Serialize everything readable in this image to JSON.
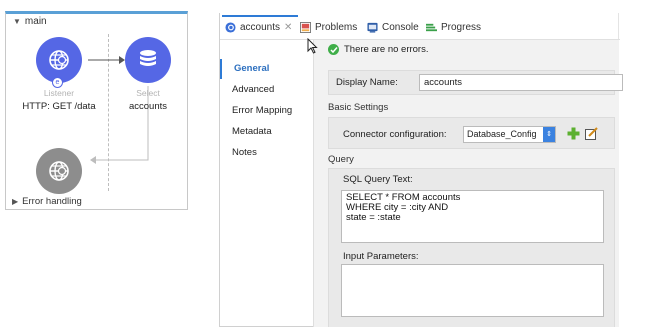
{
  "flow": {
    "name": "main",
    "listener": {
      "type": "Listener",
      "name": "HTTP: GET /data"
    },
    "select": {
      "type": "Select",
      "name": "accounts"
    },
    "error_handling": "Error handling"
  },
  "tabs": [
    {
      "label": "accounts"
    },
    {
      "label": "Problems"
    },
    {
      "label": "Console"
    },
    {
      "label": "Progress"
    }
  ],
  "nav": [
    "General",
    "Advanced",
    "Error Mapping",
    "Metadata",
    "Notes"
  ],
  "status": "There are no errors.",
  "display_name": {
    "label": "Display Name:",
    "value": "accounts"
  },
  "basic_settings": {
    "title": "Basic Settings",
    "connector_label": "Connector configuration:",
    "connector_value": "Database_Config"
  },
  "query": {
    "title": "Query",
    "sql_label": "SQL Query Text:",
    "sql_text": "SELECT * FROM accounts\nWHERE city = :city AND\nstate = :state",
    "params_label": "Input Parameters:"
  },
  "colors": {
    "accent": "#2e7bd6",
    "node_active": "#5567e5",
    "node_inactive": "#8d8d8d",
    "ok": "#3fae49"
  }
}
